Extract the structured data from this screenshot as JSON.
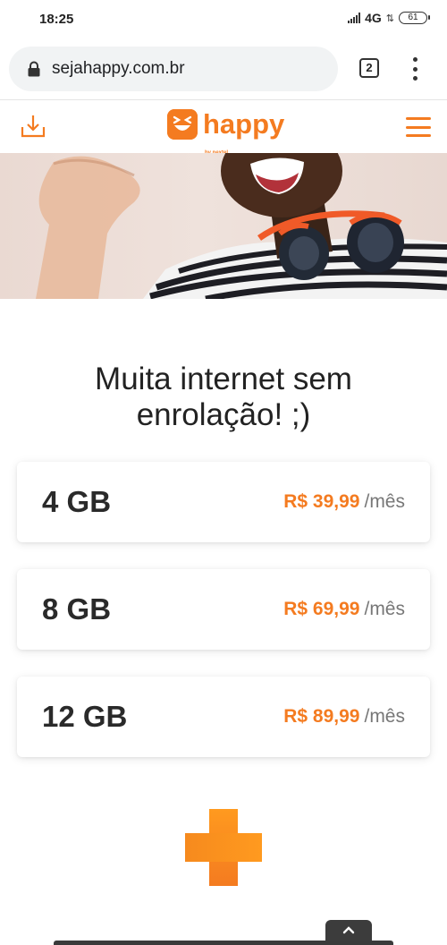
{
  "status_bar": {
    "time": "18:25",
    "network": "4G",
    "battery": "61"
  },
  "browser": {
    "url": "sejahappy.com.br",
    "tab_count": "2"
  },
  "header": {
    "logo_text": "happy",
    "logo_subtext": "by nextel"
  },
  "hero": {
    "image_name": "smiling-person-headphones-photo"
  },
  "headline": "Muita internet sem enrolação! ;)",
  "plans": [
    {
      "size": "4 GB",
      "price": "R$ 39,99",
      "period": "/mês"
    },
    {
      "size": "8 GB",
      "price": "R$ 69,99",
      "period": "/mês"
    },
    {
      "size": "12 GB",
      "price": "R$ 89,99",
      "period": "/mês"
    }
  ],
  "colors": {
    "brand_orange": "#f47b20",
    "text_dark": "#2a2a2a",
    "text_muted": "#777777"
  },
  "icons": [
    "lock-icon",
    "kebab-menu-icon",
    "download-icon",
    "logo-face-icon",
    "hamburger-menu-icon",
    "plus-icon",
    "chevron-up-icon"
  ]
}
